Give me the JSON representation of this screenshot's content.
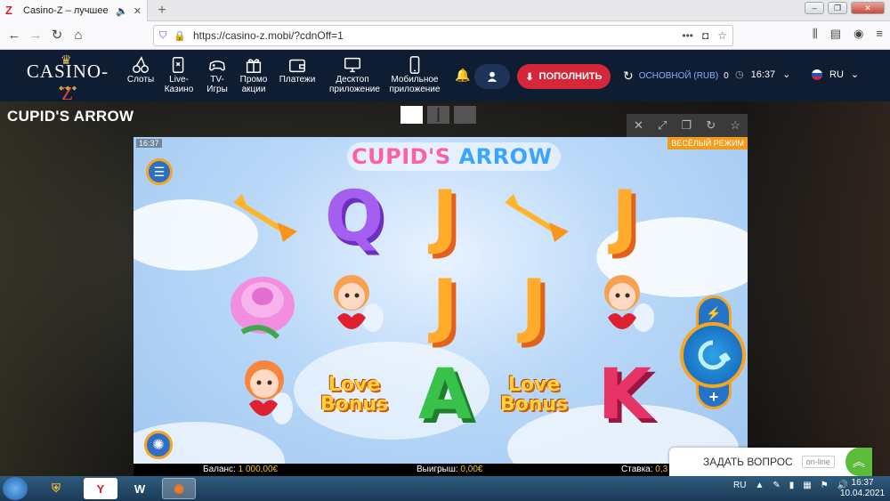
{
  "browser": {
    "tab_title": "Casino-Z – лучшее онлайн",
    "favicon_letter": "Z",
    "url": "https://casino-z.mobi/?cdnOff=1"
  },
  "site": {
    "logo_text_left": "CASINO-",
    "logo_text_right": "Z",
    "nav": [
      {
        "label": "Слоты",
        "icon": "cherries-icon"
      },
      {
        "label": "Live-Казино",
        "icon": "live-casino-icon"
      },
      {
        "label": "TV-Игры",
        "icon": "gamepad-icon"
      },
      {
        "label": "Промо акции",
        "icon": "gift-icon"
      },
      {
        "label": "Платежи",
        "icon": "wallet-icon"
      },
      {
        "label": "Десктоп приложение",
        "icon": "desktop-icon"
      },
      {
        "label": "Мобильное приложение",
        "icon": "mobile-icon"
      }
    ],
    "topup_label": "ПОПОЛНИТЬ",
    "balance_label": "ОСНОВНОЙ (RUB)",
    "balance_value": "0",
    "time": "16:37",
    "lang": "RU"
  },
  "page": {
    "game_title": "CUPID'S ARROW"
  },
  "game": {
    "time": "16:37",
    "mode_badge": "ВЕСЁЛЫЙ РЕЖИМ",
    "logo": "CUPID'S ARROW",
    "reels": [
      [
        "arrow",
        "rose",
        "cupid-girl"
      ],
      [
        "Q",
        "cupid-boy",
        "bonus"
      ],
      [
        "J",
        "J",
        "A"
      ],
      [
        "arrow",
        "J",
        "bonus"
      ],
      [
        "J",
        "cupid-boy",
        "K"
      ]
    ],
    "bonus_line1": "Love",
    "bonus_line2": "Bonus",
    "status": {
      "balance_label": "Баланс:",
      "balance_value": "1 000,00€",
      "win_label": "Выигрыш:",
      "win_value": "0,00€",
      "bet_label": "Ставка:",
      "bet_value": "0,3"
    }
  },
  "help": {
    "label": "ЗАДАТЬ ВОПРОС",
    "status": "on-line"
  },
  "taskbar": {
    "lang": "RU",
    "time": "16:37",
    "date": "10.04.2021"
  }
}
